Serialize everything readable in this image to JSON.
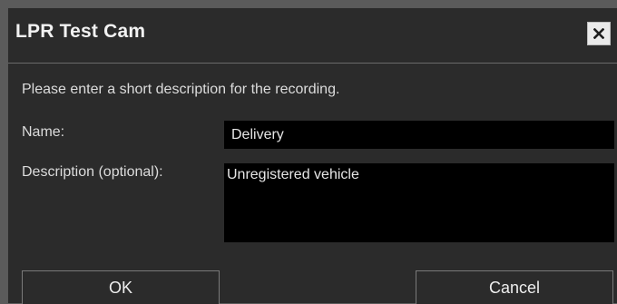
{
  "dialog": {
    "title": "LPR Test Cam",
    "close_icon": "close-icon",
    "prompt": "Please enter a short description for the recording.",
    "name_label": "Name:",
    "name_value": "Delivery",
    "description_label": "Description (optional):",
    "description_value": "Unregistered vehicle",
    "ok_label": "OK",
    "cancel_label": "Cancel"
  },
  "colors": {
    "background": "#2b2b2b",
    "input_background": "#000000",
    "text": "#dcdcdc"
  }
}
